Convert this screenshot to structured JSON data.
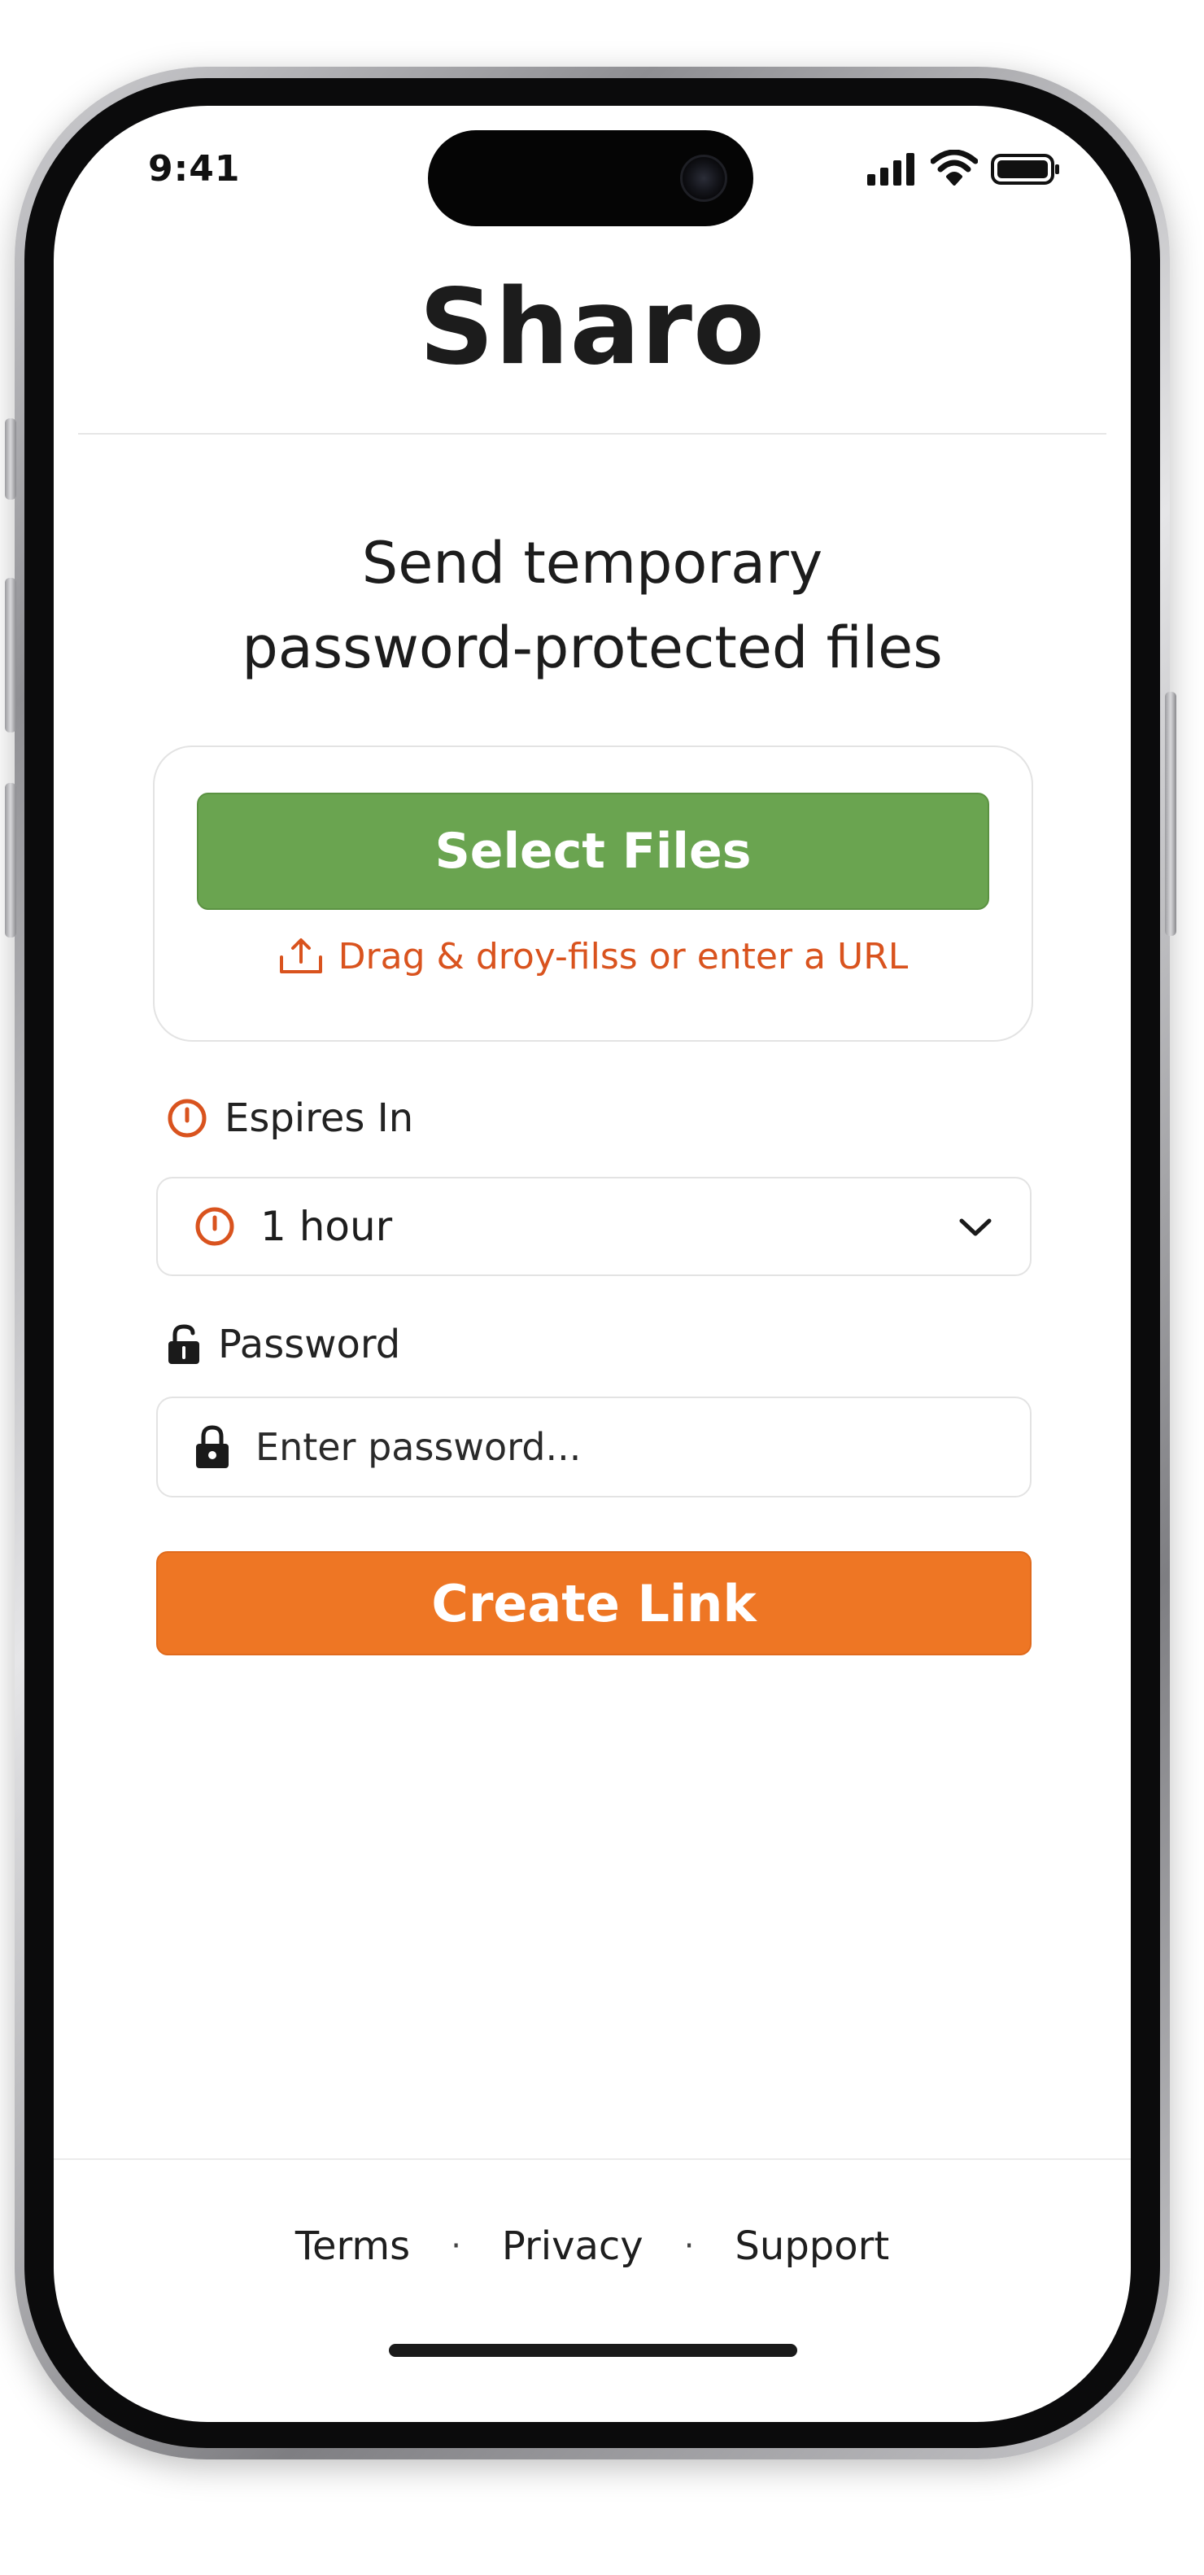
{
  "status_bar": {
    "time": "9:41",
    "icons": [
      "cellular-signal-icon",
      "wifi-icon",
      "battery-icon"
    ]
  },
  "header": {
    "title": "Sharo"
  },
  "main": {
    "headline_line1": "Send temporary",
    "headline_line2": "password-protected files",
    "upload": {
      "select_button_label": "Select Files",
      "drop_hint": "Drag & droy-filss or enter a URL",
      "hint_icon": "upload-icon"
    },
    "expiry": {
      "label": "Espires In",
      "selected_value": "1 hour",
      "icon": "clock-icon"
    },
    "password": {
      "label": "Password",
      "placeholder": "Enter password...",
      "value": "",
      "icon": "lock-icon"
    },
    "create_button_label": "Create Link"
  },
  "footer": {
    "links": [
      "Terms",
      "Privacy",
      "Support"
    ],
    "separator": "·"
  },
  "colors": {
    "accent_green": "#6aa450",
    "accent_orange": "#ee7624",
    "hint_orange": "#d9531e"
  }
}
